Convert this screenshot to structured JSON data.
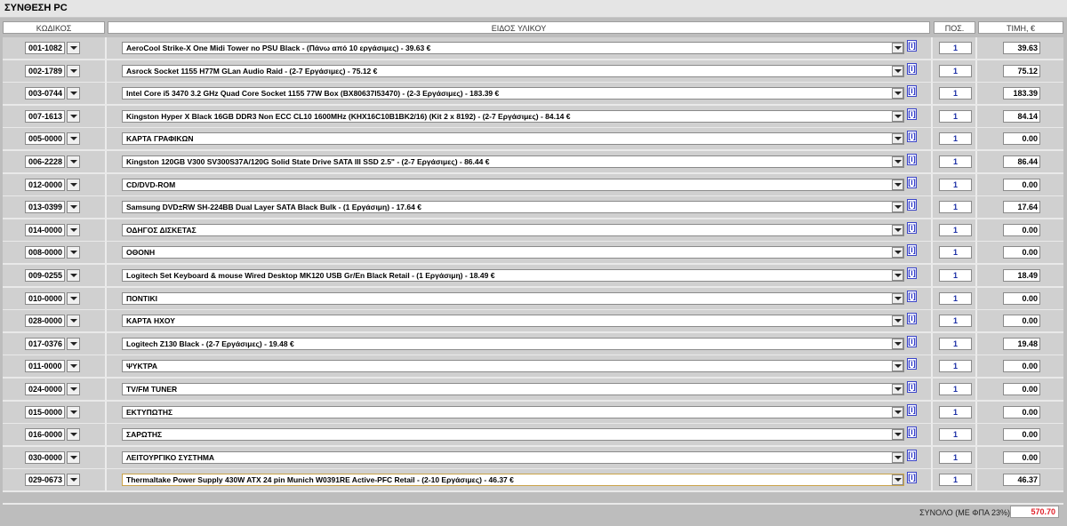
{
  "title": "ΣΥΝΘΕΣΗ PC",
  "headers": {
    "code": "ΚΩΔΙΚΟΣ",
    "item": "ΕΙΔΟΣ ΥΛΙΚΟΥ",
    "qty": "ΠΟΣ.",
    "price": "ΤΙΜΗ, €"
  },
  "info_label": "[i]",
  "rows": [
    {
      "code": "001-1082",
      "item": "AeroCool Strike-X One Midi Tower no PSU Black - (Πάνω από 10 εργάσιμες) - 39.63 €",
      "qty": "1",
      "price": "39.63"
    },
    {
      "code": "002-1789",
      "item": "Asrock Socket 1155 H77M GLan Audio Raid - (2-7 Εργάσιμες) - 75.12 €",
      "qty": "1",
      "price": "75.12"
    },
    {
      "code": "003-0744",
      "item": "Intel Core i5 3470 3.2 GHz Quad Core Socket 1155 77W Box (BX80637I53470) - (2-3 Εργάσιμες) - 183.39 €",
      "qty": "1",
      "price": "183.39"
    },
    {
      "code": "007-1613",
      "item": "Kingston Hyper X Black 16GB DDR3 Non ECC CL10 1600MHz (KHX16C10B1BK2/16) (Kit 2 x 8192) - (2-7 Εργάσιμες) - 84.14 €",
      "qty": "1",
      "price": "84.14"
    },
    {
      "code": "005-0000",
      "item": "ΚΑΡΤΑ ΓΡΑΦΙΚΩΝ",
      "qty": "1",
      "price": "0.00"
    },
    {
      "code": "006-2228",
      "item": "Kingston 120GB V300 SV300S37A/120G Solid State Drive SATA III SSD 2.5\" - (2-7 Εργάσιμες) - 86.44 €",
      "qty": "1",
      "price": "86.44"
    },
    {
      "code": "012-0000",
      "item": "CD/DVD-ROM",
      "qty": "1",
      "price": "0.00"
    },
    {
      "code": "013-0399",
      "item": "Samsung DVD±RW SH-224BB Dual Layer SATA Black Bulk - (1 Εργάσιμη) - 17.64 €",
      "qty": "1",
      "price": "17.64"
    },
    {
      "code": "014-0000",
      "item": "ΟΔΗΓΟΣ ΔΙΣΚΕΤΑΣ",
      "qty": "1",
      "price": "0.00"
    },
    {
      "code": "008-0000",
      "item": "ΟΘΟΝΗ",
      "qty": "1",
      "price": "0.00"
    },
    {
      "code": "009-0255",
      "item": "Logitech Set Keyboard & mouse Wired Desktop MK120 USB Gr/En Black Retail - (1 Εργάσιμη) - 18.49 €",
      "qty": "1",
      "price": "18.49"
    },
    {
      "code": "010-0000",
      "item": "ΠΟΝΤΙΚΙ",
      "qty": "1",
      "price": "0.00"
    },
    {
      "code": "028-0000",
      "item": "ΚΑΡΤΑ ΗΧΟΥ",
      "qty": "1",
      "price": "0.00"
    },
    {
      "code": "017-0376",
      "item": "Logitech Z130 Black - (2-7 Εργάσιμες) - 19.48 €",
      "qty": "1",
      "price": "19.48"
    },
    {
      "code": "011-0000",
      "item": "ΨΥΚΤΡΑ",
      "qty": "1",
      "price": "0.00"
    },
    {
      "code": "024-0000",
      "item": "TV/FM TUNER",
      "qty": "1",
      "price": "0.00"
    },
    {
      "code": "015-0000",
      "item": "ΕΚΤΥΠΩΤΗΣ",
      "qty": "1",
      "price": "0.00"
    },
    {
      "code": "016-0000",
      "item": "ΣΑΡΩΤΗΣ",
      "qty": "1",
      "price": "0.00"
    },
    {
      "code": "030-0000",
      "item": "ΛΕΙΤΟΥΡΓΙΚΟ ΣΥΣΤΗΜΑ",
      "qty": "1",
      "price": "0.00"
    },
    {
      "code": "029-0673",
      "item": "Thermaltake Power Supply 430W ATX 24 pin Munich W0391RE Active-PFC Retail - (2-10 Εργάσιμες) - 46.37 €",
      "qty": "1",
      "price": "46.37",
      "active": true
    }
  ],
  "total": {
    "label": "ΣΥΝΟΛΟ (ΜΕ ΦΠΑ 23%)",
    "value": "570.70",
    "color": "#e0202a"
  }
}
